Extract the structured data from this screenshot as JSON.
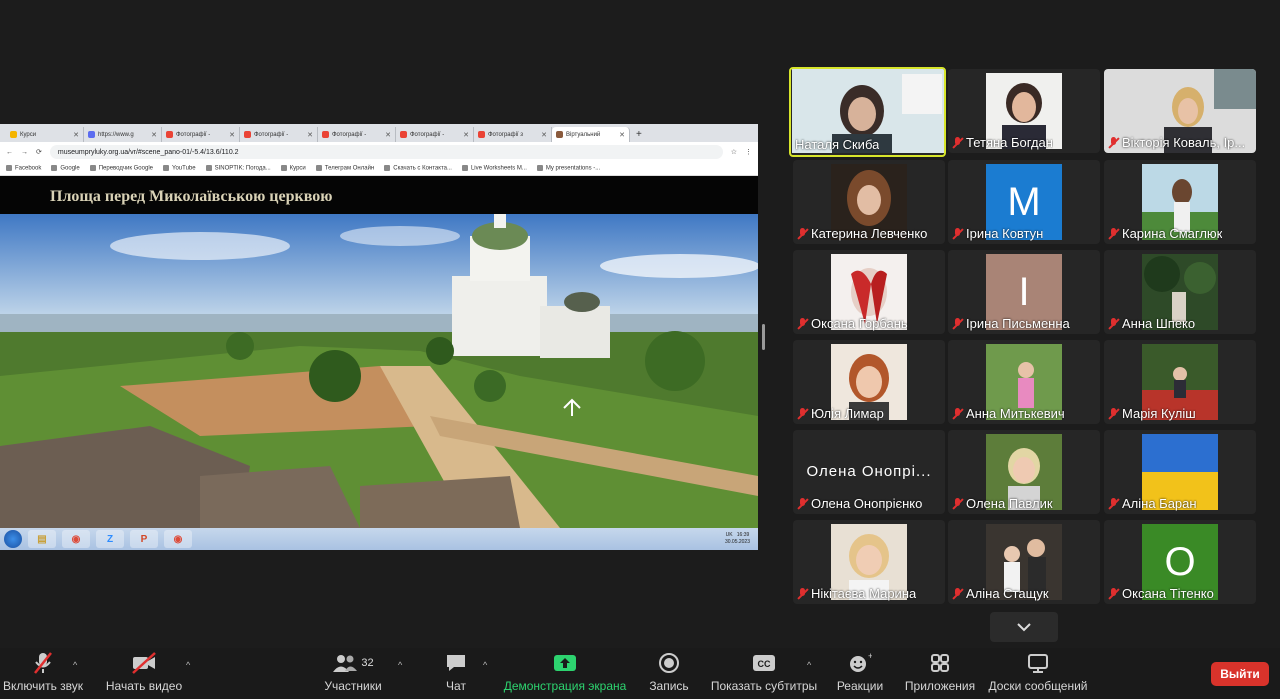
{
  "shared_screen": {
    "tabs": [
      "Курси",
      "https://www.g",
      "Фотографії -",
      "Фотографії -",
      "Фотографії -",
      "Фотографії -",
      "Фотографії з",
      "Віртуальний"
    ],
    "url": "museumpryluky.org.ua/vr/#scene_pano-01/-5.4/13.6/110.2",
    "bookmarks": [
      "Facebook",
      "Google",
      "Переводчик Google",
      "YouTube",
      "SINOPTIK: Погода...",
      "Курси",
      "Телеграм Онлайн",
      "Скачать с Контакта...",
      "Live Worksheets M...",
      "My presentations -..."
    ],
    "pano_title": "Площа перед Миколаївською церквою",
    "clock_time": "16:39",
    "clock_date": "30.05.2023",
    "lang": "UK"
  },
  "participants": [
    {
      "name": "Наталя Скиба",
      "muted": false,
      "active": true
    },
    {
      "name": "Тетяна Богдан",
      "muted": true
    },
    {
      "name": "Вікторія Коваль, Ір...",
      "muted": true
    },
    {
      "name": "Катерина Левченко",
      "muted": true
    },
    {
      "name": "Ірина Ковтун",
      "muted": true,
      "letter": "M"
    },
    {
      "name": "Карина Смаглюк",
      "muted": true
    },
    {
      "name": "Оксана Горбань",
      "muted": true
    },
    {
      "name": "Ірина Письменна",
      "muted": true,
      "letter": "I"
    },
    {
      "name": "Анна Шпеко",
      "muted": true
    },
    {
      "name": "Юлія Лимар",
      "muted": true
    },
    {
      "name": "Анна Митькевич",
      "muted": true
    },
    {
      "name": "Марія Куліш",
      "muted": true
    },
    {
      "name": "Олена Онопрієнко",
      "muted": true,
      "big_text": "Олена Онопрі..."
    },
    {
      "name": "Олена Павлик",
      "muted": true
    },
    {
      "name": "Аліна Баран",
      "muted": true
    },
    {
      "name": "Нікітаєва Марина",
      "muted": true
    },
    {
      "name": "Аліна Стащук",
      "muted": true
    },
    {
      "name": "Оксана Тітенко",
      "muted": true,
      "letter": "O"
    }
  ],
  "toolbar": {
    "unmute": "Включить звук",
    "start_video": "Начать видео",
    "participants": "Участники",
    "participants_count": "32",
    "chat": "Чат",
    "share": "Демонстрация экрана",
    "record": "Запись",
    "captions": "Показать субтитры",
    "reactions": "Реакции",
    "apps": "Приложения",
    "whiteboards": "Доски сообщений",
    "leave": "Выйти"
  },
  "colors": {
    "active_border": "#d7e52b",
    "muted_red": "#e02f2f",
    "share_green": "#2dd36f",
    "leave_red": "#d9332b"
  }
}
